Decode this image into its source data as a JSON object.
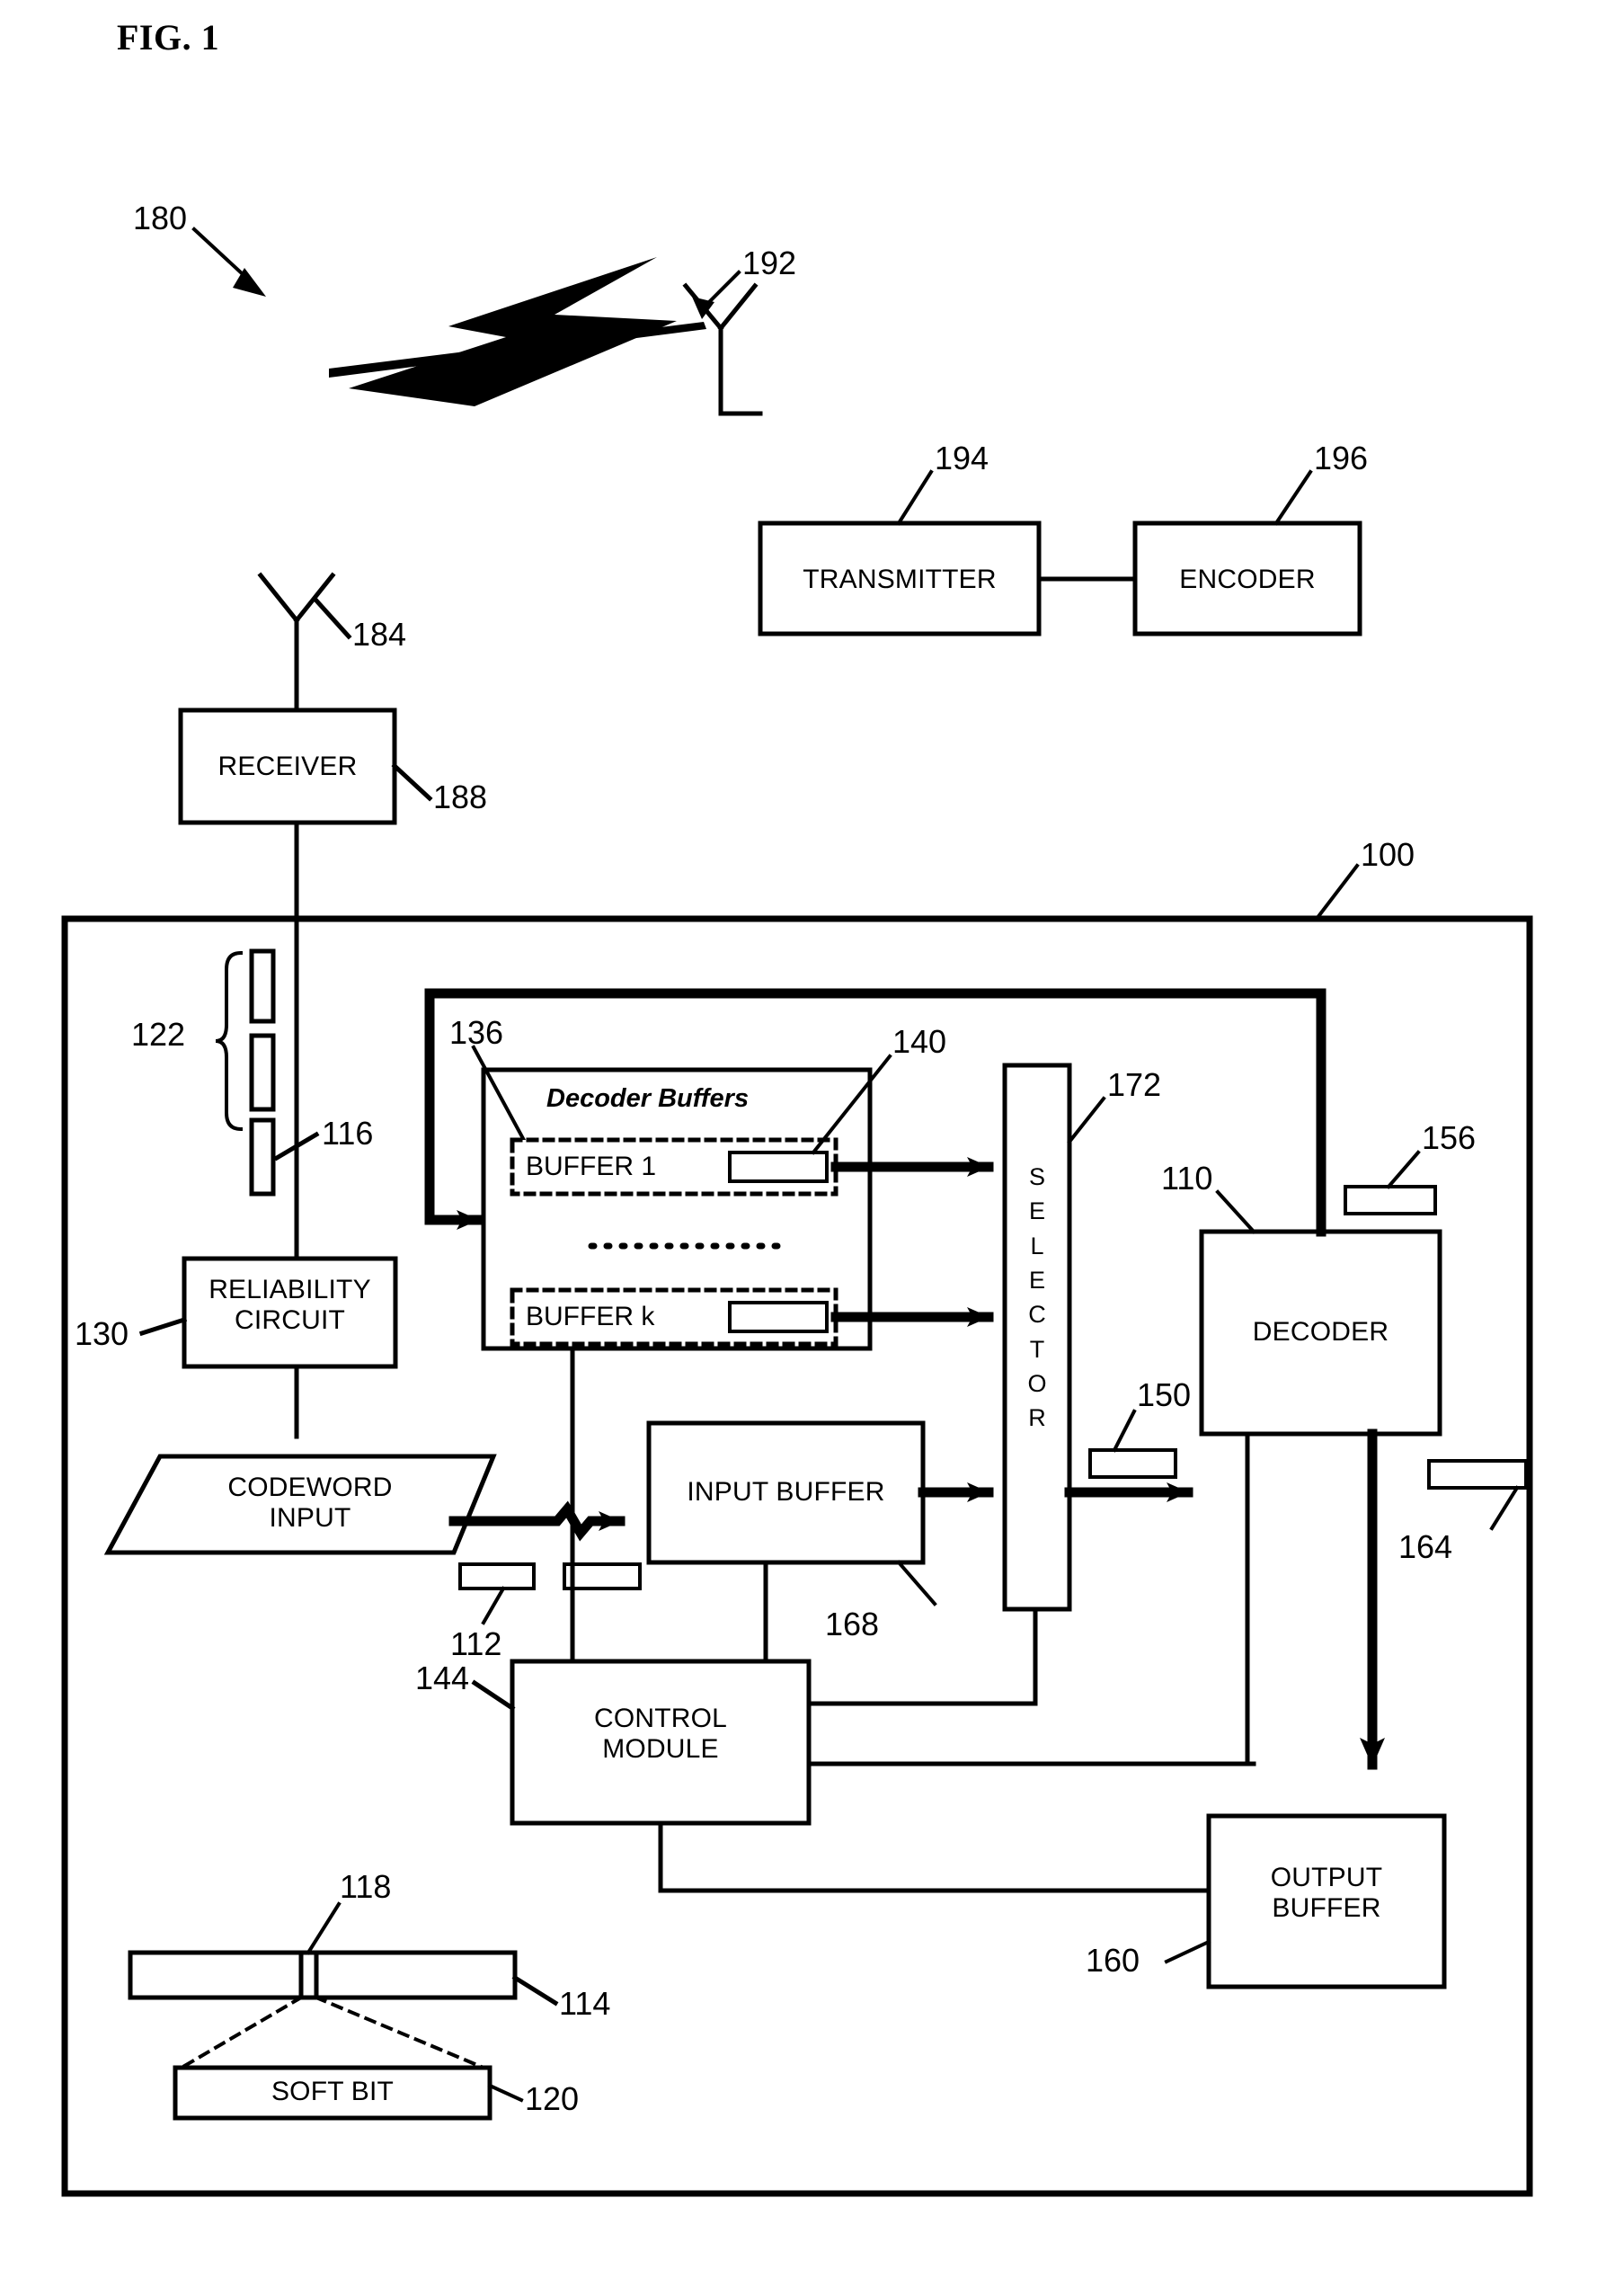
{
  "figure": {
    "title": "FIG. 1",
    "system_ref": "180",
    "decoder_system_ref": "100"
  },
  "blocks": {
    "transmitter": {
      "label": "TRANSMITTER",
      "ref": "194"
    },
    "encoder": {
      "label": "ENCODER",
      "ref": "196"
    },
    "receiver": {
      "label": "RECEIVER",
      "ref": "188"
    },
    "reliability_circuit": {
      "label": "RELIABILITY\nCIRCUIT",
      "ref": "130"
    },
    "codeword_input": {
      "label": "CODEWORD\nINPUT",
      "ref": "112"
    },
    "input_buffer": {
      "label": "INPUT BUFFER",
      "ref": "168"
    },
    "control_module": {
      "label": "CONTROL\nMODULE",
      "ref": "144"
    },
    "selector": {
      "label": "S\nE\nL\nE\nC\nT\nO\nR",
      "ref": "172"
    },
    "decoder": {
      "label": "DECODER",
      "ref": "110"
    },
    "output_buffer": {
      "label": "OUTPUT\nBUFFER",
      "ref": "160"
    },
    "decoder_buffers": {
      "label": "Decoder Buffers",
      "ref": "136"
    },
    "buffer_first": {
      "label": "BUFFER 1",
      "ref": "140"
    },
    "buffer_last": {
      "label": "BUFFER k"
    },
    "soft_bit": {
      "label": "SOFT BIT",
      "ref": "120"
    }
  },
  "antennas": {
    "transmit_antenna_ref": "192",
    "receive_antenna_ref": "184"
  },
  "refs": {
    "soft_bit_group": "122",
    "soft_bit_element": "116",
    "codeword_bar": "114",
    "bit_divider": "118",
    "decoder_input_line": "150",
    "decoder_feedback_line": "156",
    "decoder_output_line": "164"
  },
  "colors": {
    "ink": "#000000",
    "paper": "#ffffff"
  }
}
